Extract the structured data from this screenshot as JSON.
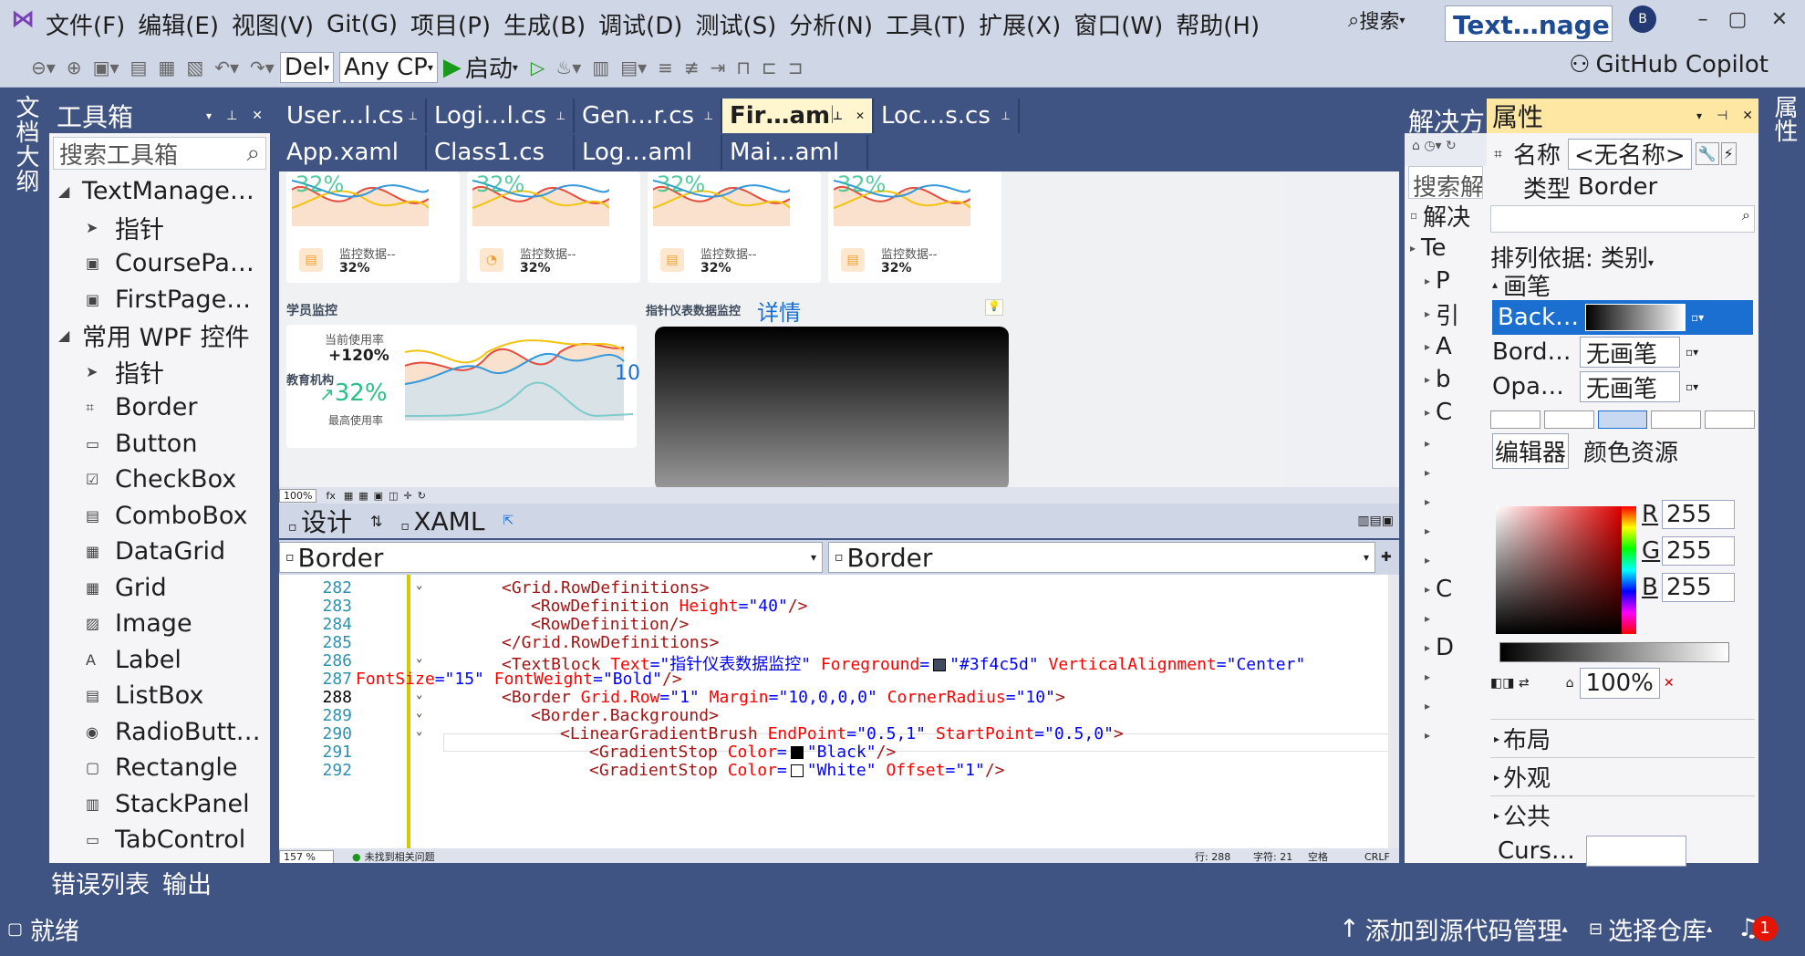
{
  "menu": {
    "items": [
      "文件(F)",
      "编辑(E)",
      "视图(V)",
      "Git(G)",
      "项目(P)",
      "生成(B)",
      "调试(D)",
      "测试(S)",
      "分析(N)",
      "工具(T)",
      "扩展(X)",
      "窗口(W)",
      "帮助(H)"
    ],
    "search": "搜索",
    "solution_title": "Text…nager",
    "avatar": "B"
  },
  "toolbar": {
    "config": "Del",
    "platform": "Any CP",
    "start": "启动",
    "copilot": "GitHub Copilot"
  },
  "left_strip": {
    "label": "文档大纲"
  },
  "toolbox": {
    "title": "工具箱",
    "search_placeholder": "搜索工具箱",
    "group1": "TextManage…",
    "items1": [
      {
        "icon": "pointer-icon",
        "label": "指针"
      },
      {
        "icon": "user-control-icon",
        "label": "CoursePa…"
      },
      {
        "icon": "user-control-icon",
        "label": "FirstPage…"
      }
    ],
    "group2": "常用 WPF 控件",
    "items2": [
      {
        "icon": "pointer-icon",
        "label": "指针"
      },
      {
        "icon": "border-icon",
        "label": "Border"
      },
      {
        "icon": "button-icon",
        "label": "Button"
      },
      {
        "icon": "checkbox-icon",
        "label": "CheckBox"
      },
      {
        "icon": "combobox-icon",
        "label": "ComboBox"
      },
      {
        "icon": "datagrid-icon",
        "label": "DataGrid"
      },
      {
        "icon": "grid-icon",
        "label": "Grid"
      },
      {
        "icon": "image-icon",
        "label": "Image"
      },
      {
        "icon": "label-icon",
        "label": "Label"
      },
      {
        "icon": "listbox-icon",
        "label": "ListBox"
      },
      {
        "icon": "radiobutton-icon",
        "label": "RadioButt…"
      },
      {
        "icon": "rectangle-icon",
        "label": "Rectangle"
      },
      {
        "icon": "stackpanel-icon",
        "label": "StackPanel"
      },
      {
        "icon": "tabcontrol-icon",
        "label": "TabControl"
      }
    ]
  },
  "doc_tabs": {
    "row1": [
      {
        "label": "User…l.cs",
        "active": false
      },
      {
        "label": "Logi…l.cs",
        "active": false
      },
      {
        "label": "Gen…r.cs",
        "active": false
      },
      {
        "label": "Fir…aml*",
        "active": true
      },
      {
        "label": "Loc…s.cs",
        "active": false
      }
    ],
    "row2": [
      "App.xaml",
      "Class1.cs",
      "Log…aml",
      "Mai…aml"
    ]
  },
  "dashboard": {
    "cards": [
      {
        "label": "监控数据--",
        "value": "32%",
        "pct": "32%"
      },
      {
        "label": "监控数据--",
        "value": "32%",
        "pct": "32%"
      },
      {
        "label": "监控数据--",
        "value": "32%",
        "pct": "32%"
      },
      {
        "label": "监控数据--",
        "value": "32%",
        "pct": "32%"
      }
    ],
    "student_title": "学员监控",
    "detail_link": "详情",
    "usage_label": "当前使用率",
    "usage_value": "+120%",
    "peak_value": "32%",
    "peak_label": "最高使用率",
    "gauge_title": "指针仪表数据监控",
    "edu_title": "教育机构",
    "ten": "10"
  },
  "designer_zoom": "100%",
  "split": {
    "design": "设计",
    "xaml": "XAML"
  },
  "combos": {
    "left": "Border",
    "right": "Border"
  },
  "editor": {
    "lines": [
      {
        "n": "282",
        "indent": 4,
        "parts": [
          [
            "tag",
            "<Grid.RowDefinitions>"
          ]
        ]
      },
      {
        "n": "283",
        "indent": 5,
        "parts": [
          [
            "tag",
            "<RowDefinition "
          ],
          [
            "att",
            "Height"
          ],
          [
            "txt",
            "="
          ],
          [
            "val",
            "\"40\""
          ],
          [
            "tag",
            "/>"
          ]
        ]
      },
      {
        "n": "284",
        "indent": 5,
        "parts": [
          [
            "tag",
            "<RowDefinition/>"
          ]
        ]
      },
      {
        "n": "285",
        "indent": 4,
        "parts": [
          [
            "tag",
            "</Grid.RowDefinitions>"
          ]
        ]
      },
      {
        "n": "286",
        "indent": 4,
        "parts": [
          [
            "tag",
            "<TextBlock "
          ],
          [
            "att",
            "Text"
          ],
          [
            "txt",
            "="
          ],
          [
            "val",
            "\"指针仪表数据监控\" "
          ],
          [
            "att",
            "Foreground"
          ],
          [
            "txt",
            "="
          ],
          [
            "swatch",
            "#3f4c5d"
          ],
          [
            "val",
            "\"#3f4c5d\" "
          ],
          [
            "att",
            "VerticalAlignment"
          ],
          [
            "txt",
            "="
          ],
          [
            "val",
            "\"Center\""
          ]
        ]
      },
      {
        "n": "287",
        "indent": 0,
        "parts": [
          [
            "att",
            "FontSize"
          ],
          [
            "txt",
            "="
          ],
          [
            "val",
            "\"15\" "
          ],
          [
            "att",
            "FontWeight"
          ],
          [
            "txt",
            "="
          ],
          [
            "val",
            "\"Bold\""
          ],
          [
            "tag",
            "/>"
          ]
        ]
      },
      {
        "n": "288",
        "indent": 4,
        "parts": [
          [
            "tag",
            "<Border "
          ],
          [
            "att",
            "Grid.Row"
          ],
          [
            "txt",
            "="
          ],
          [
            "val",
            "\"1\" "
          ],
          [
            "att",
            "Margin"
          ],
          [
            "txt",
            "="
          ],
          [
            "val",
            "\"10,0,0,0\" "
          ],
          [
            "att",
            "CornerRadius"
          ],
          [
            "txt",
            "="
          ],
          [
            "val",
            "\"10\""
          ],
          [
            "tag",
            ">"
          ]
        ]
      },
      {
        "n": "289",
        "indent": 5,
        "parts": [
          [
            "tag",
            "<Border.Background>"
          ]
        ]
      },
      {
        "n": "290",
        "indent": 6,
        "parts": [
          [
            "tag",
            "<LinearGradientBrush "
          ],
          [
            "att",
            "EndPoint"
          ],
          [
            "txt",
            "="
          ],
          [
            "val",
            "\"0.5,1\" "
          ],
          [
            "att",
            "StartPoint"
          ],
          [
            "txt",
            "="
          ],
          [
            "val",
            "\"0.5,0\""
          ],
          [
            "tag",
            ">"
          ]
        ]
      },
      {
        "n": "291",
        "indent": 7,
        "parts": [
          [
            "tag",
            "<GradientStop "
          ],
          [
            "att",
            "Color"
          ],
          [
            "txt",
            "="
          ],
          [
            "swatch",
            "#000000"
          ],
          [
            "val",
            "\"Black\""
          ],
          [
            "tag",
            "/>"
          ]
        ]
      },
      {
        "n": "292",
        "indent": 7,
        "parts": [
          [
            "tag",
            "<GradientStop "
          ],
          [
            "att",
            "Color"
          ],
          [
            "txt",
            "="
          ],
          [
            "swatch",
            "#ffffff"
          ],
          [
            "val",
            "\"White\" "
          ],
          [
            "att",
            "Offset"
          ],
          [
            "txt",
            "="
          ],
          [
            "val",
            "\"1\""
          ],
          [
            "tag",
            "/>"
          ]
        ]
      }
    ]
  },
  "editor_status": {
    "zoom": "157 %",
    "issues": "未找到相关问题",
    "line": "行: 288",
    "col": "字符: 21",
    "ws": "空格",
    "eol": "CRLF"
  },
  "bottom_tabs": [
    "错误列表",
    "输出"
  ],
  "solution_explorer": {
    "title": "解决方",
    "search": "搜索解",
    "rows": [
      "解决",
      "Te",
      "P",
      "引",
      "A",
      "b",
      "C",
      "",
      "",
      "",
      "",
      "",
      "C",
      "",
      "D",
      "",
      "",
      ""
    ]
  },
  "properties": {
    "title": "属性",
    "name_label": "名称",
    "name_value": "<无名称>",
    "type_label": "类型",
    "type_value": "Border",
    "sort_label": "排列依据: 类别",
    "brush_group": "画笔",
    "brush_rows": [
      {
        "name": "Back…",
        "value": ""
      },
      {
        "name": "Bord…",
        "value": "无画笔"
      },
      {
        "name": "Opa…",
        "value": "无画笔"
      }
    ],
    "editor_tab": "编辑器",
    "resources_tab": "颜色资源",
    "rgb": [
      {
        "l": "R",
        "v": "255"
      },
      {
        "l": "G",
        "v": "255"
      },
      {
        "l": "B",
        "v": "255"
      }
    ],
    "stop_pct": "100%",
    "groups": [
      "布局",
      "外观",
      "公共"
    ],
    "cursor_label": "Curs…"
  },
  "right_strip": {
    "label": "属性"
  },
  "status": {
    "ready": "就绪",
    "source_control": "添加到源代码管理",
    "repo": "选择仓库",
    "notif": "1"
  }
}
